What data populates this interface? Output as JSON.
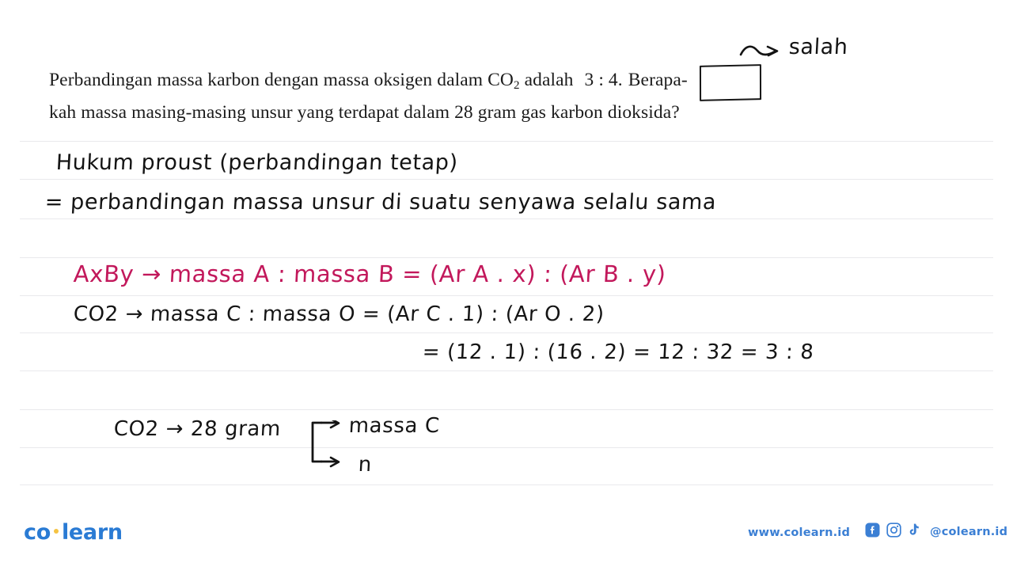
{
  "page": {
    "background": "#ffffff",
    "rule_color": "#e9e9ec",
    "rule_y_positions": [
      178,
      226,
      276,
      325,
      373,
      420,
      468,
      517,
      565,
      612
    ]
  },
  "question": {
    "line1_before": "Perbandingan massa karbon dengan massa oksigen dalam CO",
    "line1_sub": "2",
    "line1_mid": " adalah ",
    "boxed_value": "3 : 4.",
    "line1_after": "Berapa-",
    "line2": "kah massa masing-masing unsur yang terdapat dalam 28 gram gas karbon dioksida?"
  },
  "annotations": {
    "correction_label": "salah",
    "correction_ink": "#141414",
    "pink_ink": "#c2185b",
    "black_ink": "#141414",
    "lines": {
      "law_title": "Hukum proust (perbandingan tetap)",
      "law_definition": "= perbandingan massa unsur di suatu senyawa selalu sama",
      "general_formula": "AxBy → massa A : massa B = (Ar A . x) : (Ar B . y)",
      "applied_formula": "CO2 → massa C : massa O = (Ar C . 1) : (Ar O . 2)",
      "computation": "= (12 . 1)  :  (16 . 2) = 12 : 32 = 3 : 8",
      "given": "CO2 → 28 gram",
      "branch_top": "massa C",
      "branch_bottom": "n"
    }
  },
  "footer": {
    "logo_part1": "co",
    "logo_part2": "learn",
    "logo_color": "#2a7bd4",
    "logo_dot_color": "#f5c342",
    "website": "www.colearn.id",
    "handle": "@colearn.id",
    "link_color": "#3b7fd4",
    "social_icons": [
      "facebook-icon",
      "instagram-icon",
      "tiktok-icon"
    ]
  }
}
